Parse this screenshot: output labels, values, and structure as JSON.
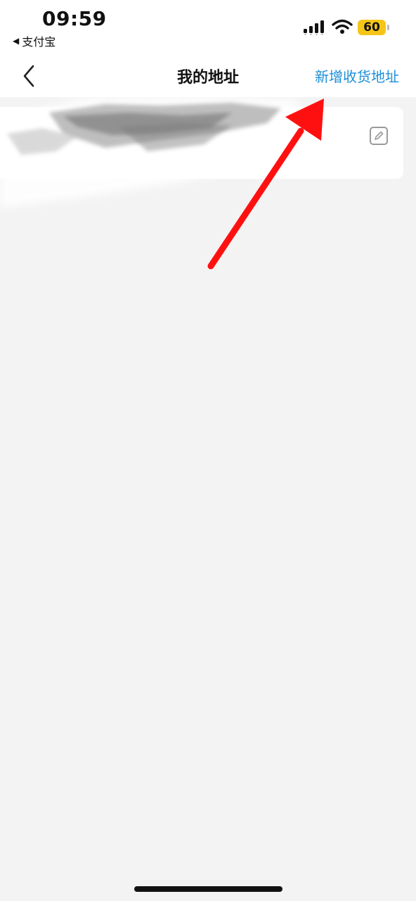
{
  "status_bar": {
    "time": "09:59",
    "back_app_label": "支付宝",
    "battery_level": "60",
    "battery_color": "#f5c518"
  },
  "nav": {
    "title": "我的地址",
    "add_address_label": "新增收货地址",
    "accent_color": "#1c8fd8"
  },
  "address_list": {
    "items_count_visible": 1,
    "item_content_obscured": true,
    "edit_icon": "edit-icon"
  },
  "annotation": {
    "arrow_color": "#ff1010",
    "arrow_points_to": "add-address-button"
  }
}
